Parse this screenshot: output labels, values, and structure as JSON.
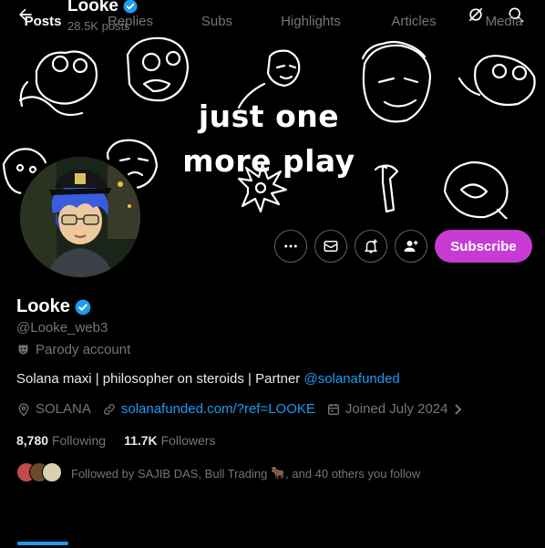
{
  "header": {
    "title": "Looke",
    "posts_count": "28.5K posts"
  },
  "banner": {
    "line1": "just one",
    "line2": "more play"
  },
  "actions": {
    "subscribe_label": "Subscribe"
  },
  "profile": {
    "name": "Looke",
    "handle": "@Looke_web3",
    "parody_label": "Parody account",
    "bio_text": "Solana maxi | philosopher on steroids | Partner ",
    "bio_mention": "@solanafunded",
    "location": "SOLANA",
    "website": "solanafunded.com/?ref=LOOKE",
    "joined": "Joined July 2024"
  },
  "stats": {
    "following_count": "8,780",
    "following_label": "Following",
    "followers_count": "11.7K",
    "followers_label": "Followers"
  },
  "followed_by": {
    "prefix": "Followed by SAJIB DAS, Bull Trading",
    "emoji": "🐂",
    "suffix": ", and 40 others you follow"
  },
  "tabs": [
    "Posts",
    "Replies",
    "Subs",
    "Highlights",
    "Articles",
    "Media"
  ],
  "colors": {
    "background": "#000000",
    "accent_blue": "#1d9bf0",
    "subscribe_purple": "#c83bd3",
    "muted_text": "#71767b"
  }
}
